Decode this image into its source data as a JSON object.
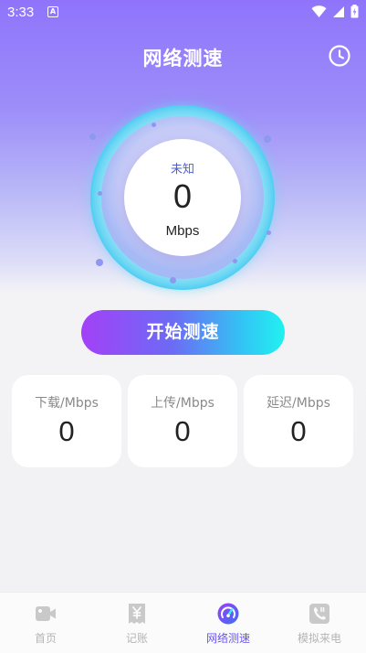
{
  "status": {
    "time": "3:33",
    "notification_badge": "A"
  },
  "header": {
    "title": "网络测速",
    "history_icon": "clock-icon"
  },
  "gauge": {
    "state": "未知",
    "value": "0",
    "unit": "Mbps"
  },
  "start_button": {
    "label": "开始测速"
  },
  "results": [
    {
      "label": "下载/Mbps",
      "value": "0"
    },
    {
      "label": "上传/Mbps",
      "value": "0"
    },
    {
      "label": "延迟/Mbps",
      "value": "0"
    }
  ],
  "tabs": [
    {
      "label": "首页",
      "icon": "video-icon",
      "active": false
    },
    {
      "label": "记账",
      "icon": "receipt-icon",
      "active": false
    },
    {
      "label": "网络测速",
      "icon": "speedometer-icon",
      "active": true
    },
    {
      "label": "模拟来电",
      "icon": "phone-icon",
      "active": false
    }
  ],
  "colors": {
    "accent": "#6a55ee",
    "header_gradient_top": "#8f74fb",
    "button_gradient_start": "#a341f7",
    "button_gradient_end": "#21f1f0",
    "inactive_tab": "#b5b5b5"
  }
}
